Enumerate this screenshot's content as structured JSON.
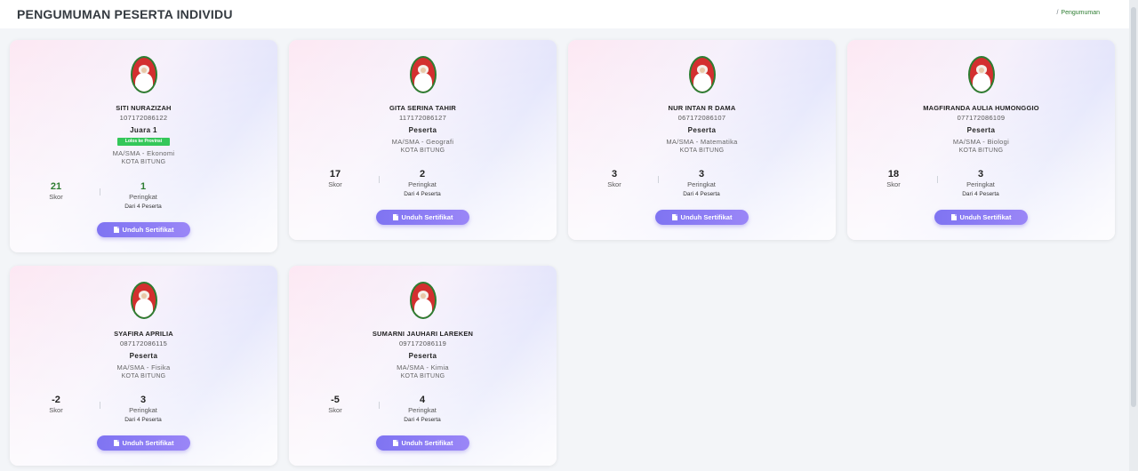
{
  "header": {
    "title": "PENGUMUMAN PESERTA INDIVIDU",
    "breadcrumb_separator": "/",
    "breadcrumb_current": "Pengumuman"
  },
  "colors": {
    "accent_green": "#2e7d32",
    "badge_green": "#34c759",
    "button_purple": "#7f74f2",
    "avatar_red": "#d32f2f"
  },
  "participants": [
    {
      "name": "SITI NURAZIZAH",
      "nim": "107172086122",
      "role": "Juara 1",
      "badge": "Lolos ke Provinsi",
      "subject": "MA/SMA - Ekonomi",
      "city": "KOTA BITUNG",
      "score": "21",
      "score_label": "Skor",
      "rank": "1",
      "rank_label": "Peringkat",
      "rank_of": "Dari 4 Peserta",
      "button": "Unduh Sertifikat"
    },
    {
      "name": "GITA SERINA TAHIR",
      "nim": "117172086127",
      "role": "Peserta",
      "subject": "MA/SMA - Geografi",
      "city": "KOTA BITUNG",
      "score": "17",
      "score_label": "Skor",
      "rank": "2",
      "rank_label": "Peringkat",
      "rank_of": "Dari 4 Peserta",
      "button": "Unduh Sertifikat"
    },
    {
      "name": "NUR INTAN R DAMA",
      "nim": "067172086107",
      "role": "Peserta",
      "subject": "MA/SMA - Matematika",
      "city": "KOTA BITUNG",
      "score": "3",
      "score_label": "Skor",
      "rank": "3",
      "rank_label": "Peringkat",
      "rank_of": "Dari 4 Peserta",
      "button": "Unduh Sertifikat"
    },
    {
      "name": "MAGFIRANDA AULIA HUMONGGIO",
      "nim": "077172086109",
      "role": "Peserta",
      "subject": "MA/SMA - Biologi",
      "city": "KOTA BITUNG",
      "score": "18",
      "score_label": "Skor",
      "rank": "3",
      "rank_label": "Peringkat",
      "rank_of": "Dari 4 Peserta",
      "button": "Unduh Sertifikat"
    },
    {
      "name": "SYAFIRA APRILIA",
      "nim": "087172086115",
      "role": "Peserta",
      "subject": "MA/SMA - Fisika",
      "city": "KOTA BITUNG",
      "score": "-2",
      "score_label": "Skor",
      "rank": "3",
      "rank_label": "Peringkat",
      "rank_of": "Dari 4 Peserta",
      "button": "Unduh Sertifikat"
    },
    {
      "name": "SUMARNI JAUHARI LAREKEN",
      "nim": "097172086119",
      "role": "Peserta",
      "subject": "MA/SMA - Kimia",
      "city": "KOTA BITUNG",
      "score": "-5",
      "score_label": "Skor",
      "rank": "4",
      "rank_label": "Peringkat",
      "rank_of": "Dari 4 Peserta",
      "button": "Unduh Sertifikat"
    }
  ]
}
